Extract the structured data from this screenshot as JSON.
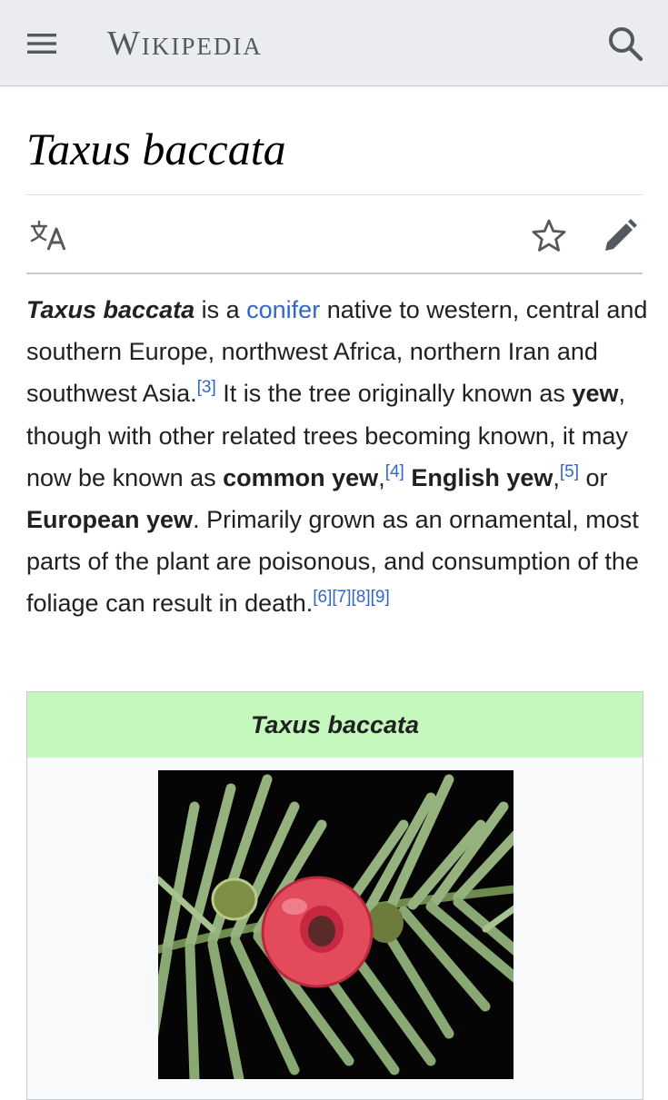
{
  "header": {
    "wordmark": "Wikipedia",
    "menu_icon": "hamburger-menu-icon",
    "search_icon": "search-icon"
  },
  "page": {
    "title": "Taxus baccata"
  },
  "actions": {
    "language_icon": "language-icon",
    "watch_icon": "star-icon",
    "edit_icon": "pencil-icon"
  },
  "lead": {
    "s1_term": "Taxus baccata",
    "s1_a": " is a ",
    "s1_link": "conifer",
    "s1_b": " native to western, central and southern Europe, northwest Africa, northern Iran and southwest Asia.",
    "ref3": "[3]",
    "s2_a": " It is the tree originally known as ",
    "s2_yew": "yew",
    "s2_b": ", though with other related trees becoming known, it may now be known as ",
    "s2_common": "common yew",
    "s2_comma1": ",",
    "ref4": "[4]",
    "s2_english": " English yew",
    "s2_comma2": ",",
    "ref5": "[5]",
    "s2_or": " or ",
    "s2_european": "European yew",
    "s3": ". Primarily grown as an ornamental, most parts of the plant are poisonous, and consumption of the foliage can result in death.",
    "ref6": "[6]",
    "ref7": "[7]",
    "ref8": "[8]",
    "ref9": "[9]"
  },
  "infobox": {
    "title": "Taxus baccata",
    "image_subject": "yew-branch-with-red-aril"
  },
  "colors": {
    "header_bg": "#eaecf0",
    "link": "#3366cc",
    "infobox_header": "#c4f8bc",
    "aril_red": "#e8485a",
    "needle_green": "#8fb078"
  }
}
